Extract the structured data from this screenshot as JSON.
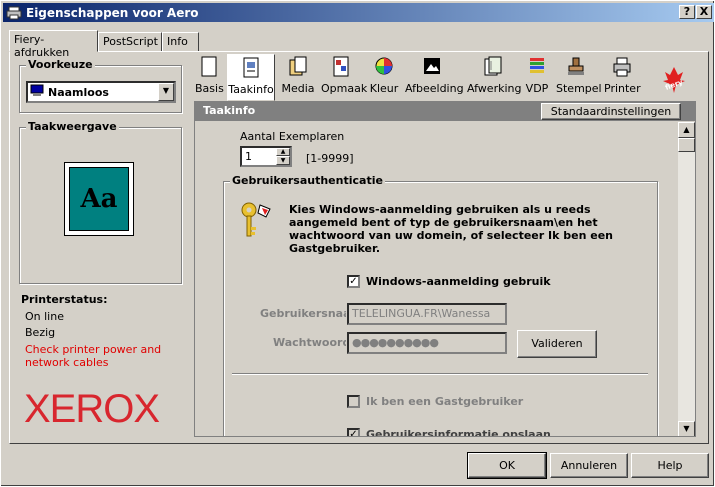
{
  "window": {
    "title": "Eigenschappen voor Aero"
  },
  "titlebar": {
    "help": "?",
    "close": "X"
  },
  "tabs": [
    {
      "label": "Fiery-afdrukken"
    },
    {
      "label": "PostScript"
    },
    {
      "label": "Info"
    }
  ],
  "left": {
    "preset_label": "Voorkeuze",
    "preset_value": "Naamloos",
    "preview_label": "Taakweergave",
    "preview_text": "Aa",
    "status_label": "Printerstatus:",
    "status_lines": [
      "On line",
      "Bezig"
    ],
    "status_warning": "Check printer power and network cables",
    "brand": "XEROX"
  },
  "toolbar": [
    {
      "label": "Basis",
      "icon": "page-icon"
    },
    {
      "label": "Taakinfo",
      "icon": "job-info-icon"
    },
    {
      "label": "Media",
      "icon": "media-icon"
    },
    {
      "label": "Opmaak",
      "icon": "layout-icon"
    },
    {
      "label": "Kleur",
      "icon": "color-wheel-icon"
    },
    {
      "label": "Afbeelding",
      "icon": "image-icon"
    },
    {
      "label": "Afwerking",
      "icon": "finishing-icon"
    },
    {
      "label": "VDP",
      "icon": "vdp-icon"
    },
    {
      "label": "Stempel",
      "icon": "stamp-icon"
    },
    {
      "label": "Printer",
      "icon": "printer-icon"
    }
  ],
  "fiery_logo": "fiery",
  "section": {
    "title": "Taakinfo",
    "defaults_button": "Standaardinstellingen"
  },
  "copies": {
    "label": "Aantal Exemplaren",
    "value": "1",
    "range": "[1-9999]"
  },
  "auth": {
    "group_label": "Gebruikersauthenticatie",
    "description": "Kies Windows-aanmelding gebruiken als u reeds aangemeld bent of typ de gebruikersnaam\\en het wachtwoord van uw domein, of selecteer Ik ben een Gastgebruiker.",
    "windows_login_label": "Windows-aanmelding gebruik",
    "windows_login_checked": true,
    "username_label": "Gebruikersnaam",
    "username_value": "TELELINGUA.FR\\Wanessa",
    "password_label": "Wachtwoord",
    "password_value": "●●●●●●●●●●",
    "validate_button": "Valideren",
    "guest_label": "Ik ben een Gastgebruiker",
    "send_info_label": "Gebruikersinformatie opslaan"
  },
  "footer": {
    "ok": "OK",
    "cancel": "Annuleren",
    "help": "Help"
  },
  "colors": {
    "title_start": "#0a246a",
    "title_end": "#a6caf0",
    "warning": "#cc0000",
    "xerox": "#d8262e",
    "preview_fill": "#008080"
  }
}
